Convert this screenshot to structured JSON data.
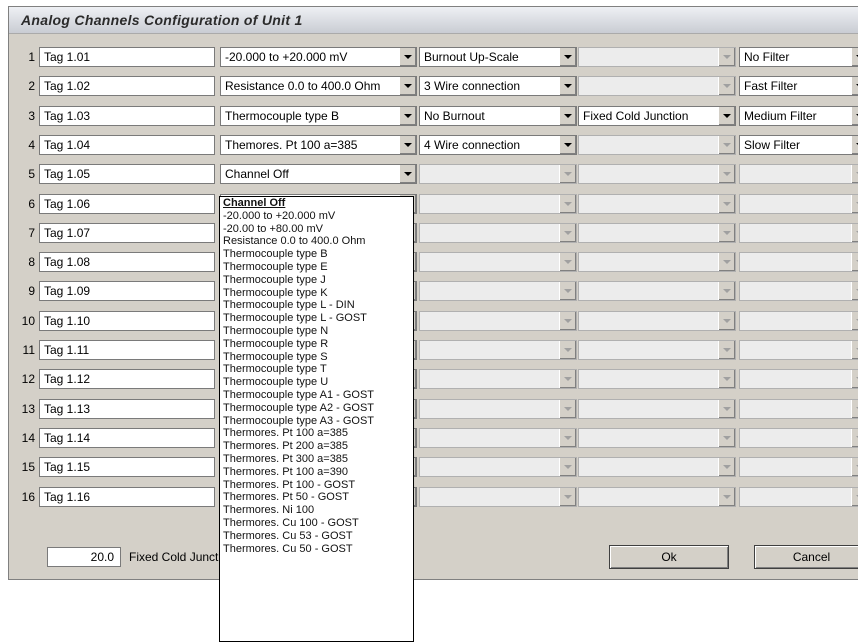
{
  "window": {
    "title": "Analog Channels Configuration of Unit 1"
  },
  "rows": [
    {
      "num": "1",
      "tag": "Tag 1.01",
      "range": "-20.000 to +20.000 mV",
      "connection": "Burnout Up-Scale",
      "junction": "",
      "filter": "No Filter",
      "enabled": true
    },
    {
      "num": "2",
      "tag": "Tag 1.02",
      "range": "Resistance 0.0 to 400.0 Ohm",
      "connection": "3 Wire connection",
      "junction": "",
      "filter": "Fast Filter",
      "enabled": true
    },
    {
      "num": "3",
      "tag": "Tag 1.03",
      "range": "Thermocouple type B",
      "connection": "No Burnout",
      "junction": "Fixed Cold Junction",
      "filter": "Medium Filter",
      "enabled": true
    },
    {
      "num": "4",
      "tag": "Tag 1.04",
      "range": "Themores. Pt 100 a=385",
      "connection": "4 Wire connection",
      "junction": "",
      "filter": "Slow Filter",
      "enabled": true
    },
    {
      "num": "5",
      "tag": "Tag 1.05",
      "range": "Channel Off",
      "connection": "",
      "junction": "",
      "filter": "",
      "enabled": false
    },
    {
      "num": "6",
      "tag": "Tag 1.06",
      "range": "",
      "connection": "",
      "junction": "",
      "filter": "",
      "enabled": false
    },
    {
      "num": "7",
      "tag": "Tag 1.07",
      "range": "",
      "connection": "",
      "junction": "",
      "filter": "",
      "enabled": false
    },
    {
      "num": "8",
      "tag": "Tag 1.08",
      "range": "",
      "connection": "",
      "junction": "",
      "filter": "",
      "enabled": false
    },
    {
      "num": "9",
      "tag": "Tag 1.09",
      "range": "",
      "connection": "",
      "junction": "",
      "filter": "",
      "enabled": false
    },
    {
      "num": "10",
      "tag": "Tag 1.10",
      "range": "",
      "connection": "",
      "junction": "",
      "filter": "",
      "enabled": false
    },
    {
      "num": "11",
      "tag": "Tag 1.11",
      "range": "",
      "connection": "",
      "junction": "",
      "filter": "",
      "enabled": false
    },
    {
      "num": "12",
      "tag": "Tag 1.12",
      "range": "",
      "connection": "",
      "junction": "",
      "filter": "",
      "enabled": false
    },
    {
      "num": "13",
      "tag": "Tag 1.13",
      "range": "",
      "connection": "",
      "junction": "",
      "filter": "",
      "enabled": false
    },
    {
      "num": "14",
      "tag": "Tag 1.14",
      "range": "",
      "connection": "",
      "junction": "",
      "filter": "",
      "enabled": false
    },
    {
      "num": "15",
      "tag": "Tag 1.15",
      "range": "",
      "connection": "",
      "junction": "",
      "filter": "",
      "enabled": false
    },
    {
      "num": "16",
      "tag": "Tag 1.16",
      "range": "",
      "connection": "",
      "junction": "",
      "filter": "",
      "enabled": false
    }
  ],
  "dropdown": {
    "selected": "Channel Off",
    "options": [
      "Channel Off",
      "-20.000 to +20.000 mV",
      "-20.00 to +80.00 mV",
      "Resistance 0.0 to 400.0 Ohm",
      "Thermocouple type B",
      "Thermocouple type E",
      "Thermocouple type J",
      "Thermocouple type K",
      "Thermocouple type L - DIN",
      "Thermocouple type L - GOST",
      "Thermocouple type N",
      "Thermocouple type R",
      "Thermocouple type S",
      "Thermocouple type T",
      "Thermocouple type U",
      "Thermocouple type A1 - GOST",
      "Thermocouple type A2 - GOST",
      "Thermocouple type A3 - GOST",
      "Thermores. Pt 100 a=385",
      "Thermores. Pt 200 a=385",
      "Thermores. Pt 300 a=385",
      "Thermores. Pt 100 a=390",
      "Thermores. Pt 100 - GOST",
      "Thermores. Pt 50 - GOST",
      "Thermores. Ni 100",
      "Thermores. Cu 100 - GOST",
      "Thermores. Cu 53 - GOST",
      "Thermores. Cu 50 - GOST"
    ]
  },
  "footer": {
    "cold_junction_value": "20.0",
    "cold_junction_label": "Fixed Cold Junct",
    "ok_label": "Ok",
    "cancel_label": "Cancel"
  }
}
